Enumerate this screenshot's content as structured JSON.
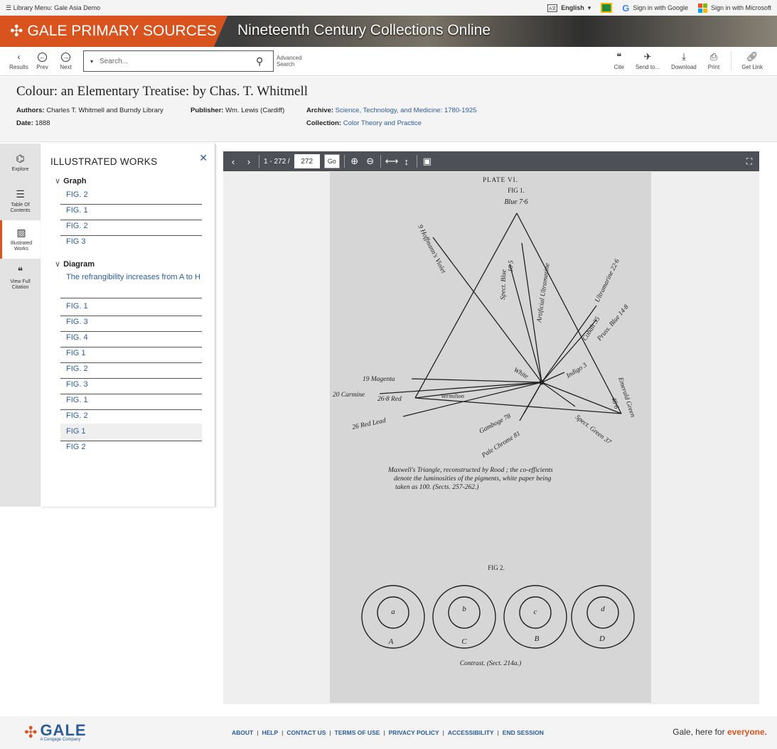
{
  "topbar": {
    "library_menu": "Library Menu: Gale Asia Demo",
    "language": "English",
    "google": "Sign in with Google",
    "microsoft": "Sign in with Microsoft"
  },
  "banner": {
    "brand": "GALE PRIMARY SOURCES",
    "collection": "Nineteenth Century Collections Online"
  },
  "toolbar": {
    "results": "Results",
    "prev": "Prev",
    "next": "Next",
    "search_placeholder": "Search...",
    "advanced_line1": "Advanced",
    "advanced_line2": "Search",
    "cite": "Cite",
    "send_to": "Send to...",
    "download": "Download",
    "print": "Print",
    "get_link": "Get Link"
  },
  "document": {
    "title": "Colour: an Elementary Treatise: by Chas. T. Whitmell",
    "authors_label": "Authors:",
    "authors": "Charles T. Whitmell and Burndy Library",
    "publisher_label": "Publisher:",
    "publisher": "Wm. Lewis (Cardiff)",
    "date_label": "Date:",
    "date": "1888",
    "archive_label": "Archive:",
    "archive": "Science, Technology, and Medicine: 1780-1925",
    "collection_label": "Collection:",
    "collection": "Color Theory and Practice"
  },
  "rail": {
    "explore": "Explore",
    "toc_line1": "Table Of",
    "toc_line2": "Contents",
    "illustrated_line1": "Illustrated",
    "illustrated_line2": "Works",
    "citation_line1": "View Full",
    "citation_line2": "Citation"
  },
  "panel": {
    "heading": "ILLUSTRATED WORKS",
    "group_graph": "Graph",
    "graph_items": [
      "FIG. 2",
      "FIG. 1",
      "FIG. 2",
      "FIG 3"
    ],
    "group_diagram": "Diagram",
    "diagram_items": [
      "The refrangibility increases from A to H",
      "FIG. 1",
      "FIG. 3",
      "FIG. 4",
      "FIG 1",
      "FIG. 2",
      "FIG. 3",
      "FIG. 1",
      "FIG. 2",
      "FIG 1",
      "FIG 2"
    ]
  },
  "viewer": {
    "page_range": "1 - 272 /",
    "page_input": "272",
    "go": "Go"
  },
  "scan": {
    "plate": "PLATE VI.",
    "fig1": "FIG 1.",
    "blue": "Blue 7·6",
    "hoffmann": "9 Hoffmann's Violet",
    "spect_blue": "Spect. Blue",
    "spect_blue_val": "10·5",
    "art_ultra": "Artificial Ultramarine",
    "ultra": "Ultramarine 22·6",
    "cobalt": "Cobalt 35",
    "pruss": "Pruss. Blue 14·8",
    "indigo": "Indigo 3",
    "white": "White",
    "magenta": "19 Magenta",
    "carmine": "20 Carmine",
    "red": "26·8 Red",
    "vermilion": "Vermilion",
    "red_lead": "26 Red Lead",
    "gamboge": "Gamboge 78",
    "pale_chrome": "Pale Chrome 81",
    "spect_green": "Spect. Green 37",
    "emerald": "Emerald Green",
    "emerald_val": "48·6",
    "caption_1": "Maxwell's Triangle, reconstructed by Rood ; the co-efficients",
    "caption_2": "denote the luminosities of the pigments, white paper being",
    "caption_3": "taken as 100.   (Sects. 257-262.)",
    "fig2": "FIG 2.",
    "circle_inner": [
      "a",
      "b",
      "c",
      "d"
    ],
    "circle_outer": [
      "A",
      "C",
      "B",
      "D"
    ],
    "contrast": "Contrast.   (Sect. 214a.)"
  },
  "footer": {
    "logo": "GALE",
    "logo_sub": "A Cengage Company",
    "about": "ABOUT",
    "help": "HELP",
    "contact": "CONTACT US",
    "terms": "TERMS OF USE",
    "privacy": "PRIVACY POLICY",
    "accessibility": "ACCESSIBILITY",
    "end_session": "END SESSION",
    "tagline_pre": "Gale, here for",
    "tagline_em": "everyone."
  },
  "colors": {
    "accent": "#d9531e",
    "link": "#2b5d9c",
    "viewer_bar": "#4d5157"
  }
}
